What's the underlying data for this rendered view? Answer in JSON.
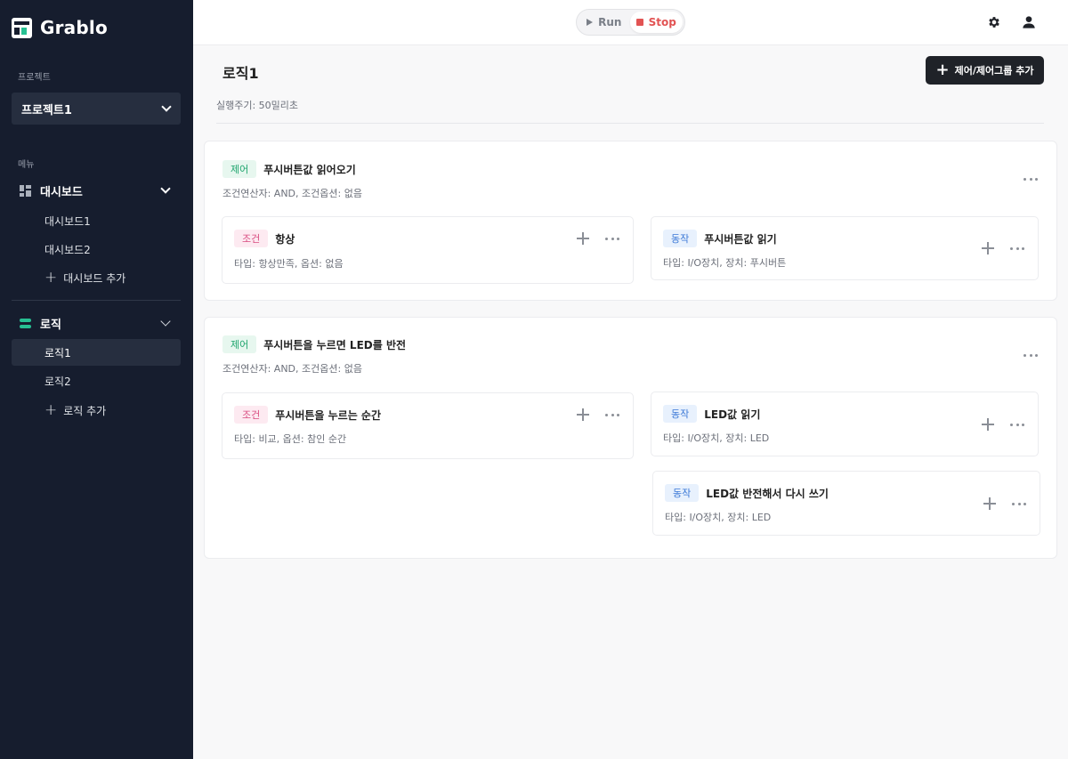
{
  "app": {
    "name": "Grablo"
  },
  "sidebar": {
    "project_label": "프로젝트",
    "project_selected": "프로젝트1",
    "menu_label": "메뉴",
    "dashboard": {
      "label": "대시보드",
      "items": [
        "대시보드1",
        "대시보드2"
      ],
      "add_label": "대시보드 추가"
    },
    "logic": {
      "label": "로직",
      "items": [
        "로직1",
        "로직2"
      ],
      "add_label": "로직 추가",
      "active_item": "로직1"
    }
  },
  "topbar": {
    "run_label": "Run",
    "stop_label": "Stop"
  },
  "main": {
    "title": "로직1",
    "add_button_label": "제어/제어그룹 추가",
    "cycle_text": "실행주기: 50밀리초",
    "groups": [
      {
        "tag": "제어",
        "title": "푸시버튼값 읽어오기",
        "subtitle": "조건연산자: AND, 조건옵션: 없음",
        "condition": {
          "tag": "조건",
          "title": "항상",
          "subtitle": "타입: 항상만족, 옵션: 없음"
        },
        "actions": [
          {
            "tag": "동작",
            "title": "푸시버튼값 읽기",
            "subtitle": "타입: I/O장치, 장치: 푸시버튼"
          }
        ]
      },
      {
        "tag": "제어",
        "title": "푸시버튼을 누르면 LED를 반전",
        "subtitle": "조건연산자: AND, 조건옵션: 없음",
        "condition": {
          "tag": "조건",
          "title": "푸시버튼을 누르는 순간",
          "subtitle": "타입: 비교, 옵션: 참인 순간"
        },
        "actions": [
          {
            "tag": "동작",
            "title": "LED값 읽기",
            "subtitle": "타입: I/O장치, 장치: LED"
          },
          {
            "tag": "동작",
            "title": "LED값 반전해서 다시 쓰기",
            "subtitle": "타입: I/O장치, 장치: LED"
          }
        ]
      }
    ]
  },
  "colors": {
    "sidebar_bg": "#161d2e",
    "accent_green": "#27c093",
    "stop_red": "#e25353"
  }
}
